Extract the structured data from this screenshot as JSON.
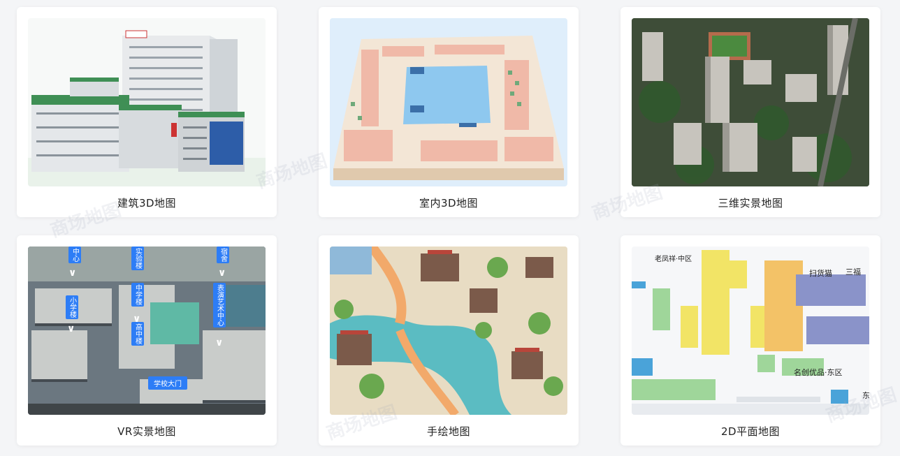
{
  "cards": [
    {
      "title": "建筑3D地图"
    },
    {
      "title": "室内3D地图"
    },
    {
      "title": "三维实景地图"
    },
    {
      "title": "VR实景地图"
    },
    {
      "title": "手绘地图"
    },
    {
      "title": "2D平面地图"
    }
  ],
  "vr_labels": {
    "center": "中心",
    "lab": "实验楼",
    "dorm": "宿舍",
    "middle": "中学楼",
    "primary": "小学楼",
    "arts": "表演艺术中心",
    "gate": "学校大门",
    "hp": "高中楼"
  },
  "plan_labels": {
    "a": "老凤祥·中区",
    "b": "扫货猫",
    "c": "三福",
    "d": "名创优品·东区",
    "e": "东"
  },
  "watermark": "商场地图"
}
